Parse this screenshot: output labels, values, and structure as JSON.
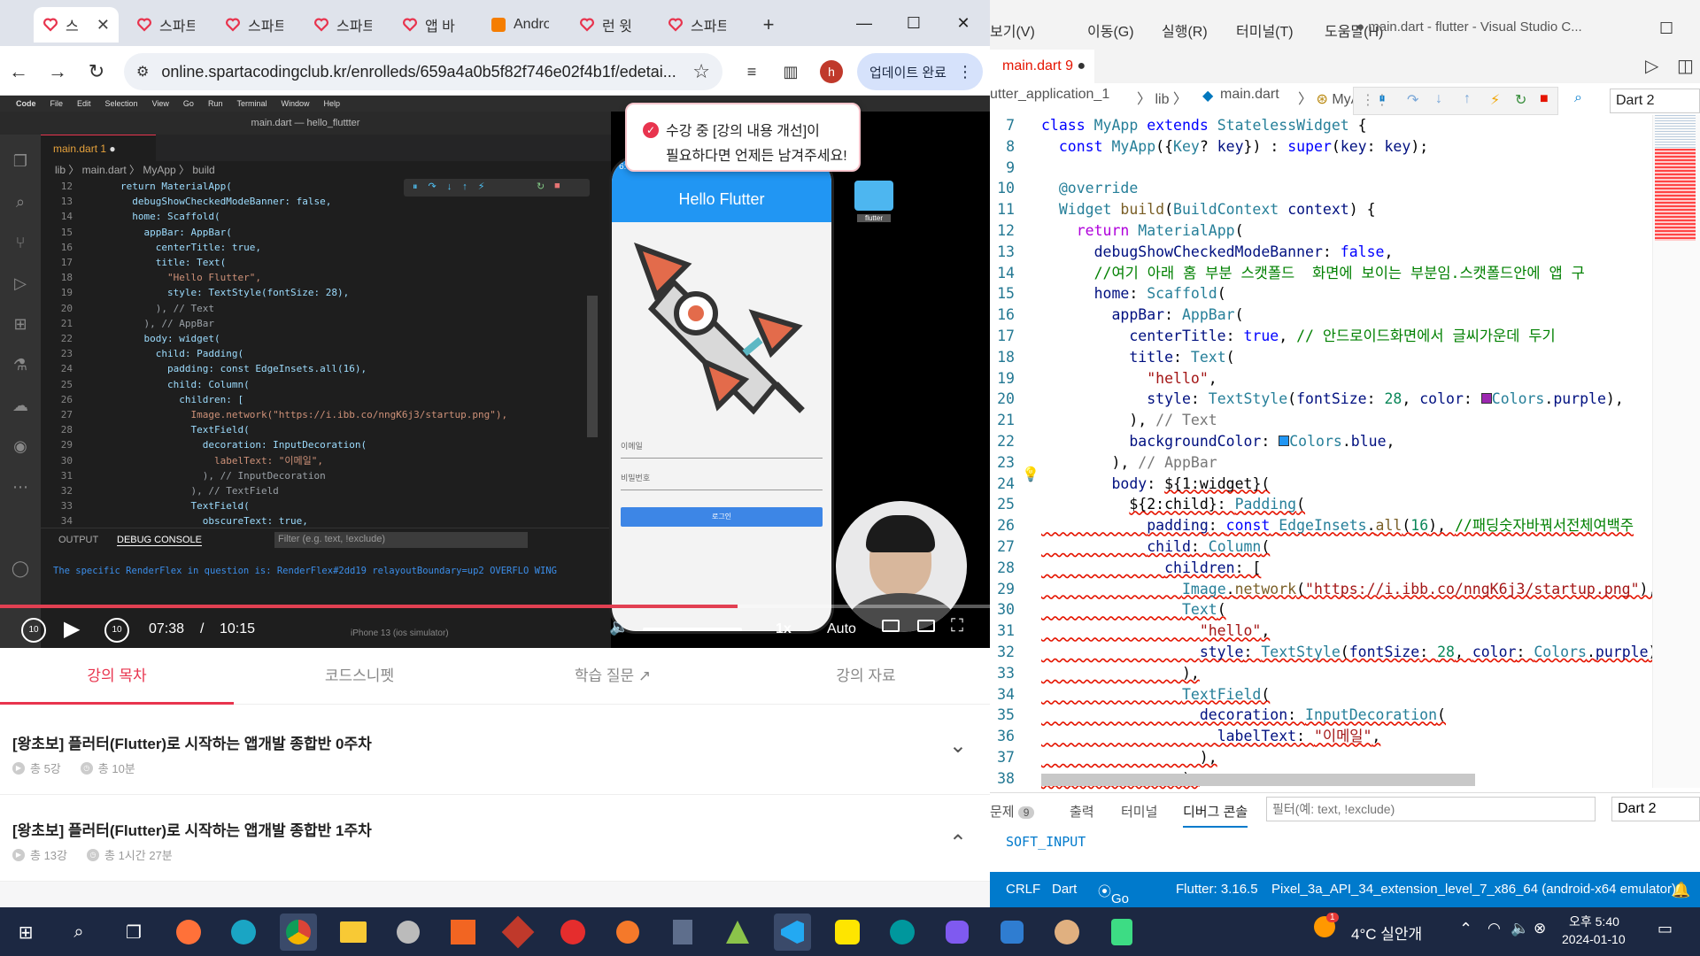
{
  "chrome": {
    "tabs": [
      {
        "label": "스"
      },
      {
        "label": "스파트"
      },
      {
        "label": "스파트"
      },
      {
        "label": "스파트"
      },
      {
        "label": "앱 바"
      },
      {
        "label": "Andro"
      },
      {
        "label": "런 윗"
      },
      {
        "label": "스파트"
      }
    ],
    "new_tab": "+",
    "url": "online.spartacodingclub.kr/enrolleds/659a4a0b5f82f746e02f4b1f/edetai...",
    "profile_initial": "h",
    "update_label": "업데이트 완료",
    "colors": {
      "accent": "#e8344e",
      "update_bg": "#d6e2fb"
    }
  },
  "video": {
    "mac_menu": [
      "Code",
      "File",
      "Edit",
      "Selection",
      "View",
      "Go",
      "Run",
      "Terminal",
      "Window",
      "Help"
    ],
    "window_title": "main.dart — hello_fluttter",
    "tab_label": "main.dart 1",
    "breadcrumb": "lib 〉 main.dart 〉 MyApp 〉 build",
    "code_lines": [
      {
        "n": "12",
        "t": "return MaterialApp("
      },
      {
        "n": "13",
        "t": "  debugShowCheckedModeBanner: false,"
      },
      {
        "n": "14",
        "t": "  home: Scaffold("
      },
      {
        "n": "15",
        "t": "    appBar: AppBar("
      },
      {
        "n": "16",
        "t": "      centerTitle: true,"
      },
      {
        "n": "17",
        "t": "      title: Text("
      },
      {
        "n": "18",
        "t": "        \"Hello Flutter\","
      },
      {
        "n": "19",
        "t": "        style: TextStyle(fontSize: 28),"
      },
      {
        "n": "20",
        "t": "      ), // Text"
      },
      {
        "n": "21",
        "t": "    ), // AppBar"
      },
      {
        "n": "22",
        "t": "    body: widget("
      },
      {
        "n": "23",
        "t": "      child: Padding("
      },
      {
        "n": "24",
        "t": "        padding: const EdgeInsets.all(16),"
      },
      {
        "n": "25",
        "t": "        child: Column("
      },
      {
        "n": "26",
        "t": "          children: ["
      },
      {
        "n": "27",
        "t": "            Image.network(\"https://i.ibb.co/nngK6j3/startup.png\"),"
      },
      {
        "n": "28",
        "t": "            TextField("
      },
      {
        "n": "29",
        "t": "              decoration: InputDecoration("
      },
      {
        "n": "30",
        "t": "                labelText: \"이메일\","
      },
      {
        "n": "31",
        "t": "              ), // InputDecoration"
      },
      {
        "n": "32",
        "t": "            ), // TextField"
      },
      {
        "n": "33",
        "t": "            TextField("
      },
      {
        "n": "34",
        "t": "              obscureText: true,"
      }
    ],
    "panel_tabs": [
      "OUTPUT",
      "DEBUG CONSOLE"
    ],
    "panel_filter": "Filter (e.g. text, !exclude)",
    "console_text": "The specific RenderFlex in question is: RenderFlex#2dd19 relayoutBoundary=up2 OVERFLO WING",
    "status_hint": "iPhone 13 (ios simulator)",
    "phone": {
      "time": "6:04",
      "appbar_title": "Hello Flutter",
      "email_label": "이메일",
      "password_label": "비밀번호",
      "login_button": "로그인"
    },
    "toast": {
      "line1": "수강 중 [강의 내용 개선]이",
      "line2": "필요하다면 언제든 남겨주세요!"
    },
    "folder_label": "flutter",
    "player": {
      "current_time": "07:38",
      "separator": "/",
      "duration": "10:15",
      "speed": "1x",
      "quality": "Auto",
      "progress": 0.745,
      "rewind_label": "10",
      "forward_label": "10"
    }
  },
  "lecture": {
    "tabs": [
      {
        "label": "강의 목차",
        "active": true
      },
      {
        "label": "코드스니펫",
        "active": false
      },
      {
        "label": "학습 질문",
        "active": false
      },
      {
        "label": "강의 자료",
        "active": false
      }
    ],
    "sections": [
      {
        "title": "[왕초보] 플러터(Flutter)로 시작하는 앱개발 종합반 0주차",
        "count": "총 5강",
        "time": "총 10분",
        "chevron": "⌄"
      },
      {
        "title": "[왕초보] 플러터(Flutter)로 시작하는 앱개발 종합반 1주차",
        "count": "총 13강",
        "time": "총 1시간 27분",
        "chevron": "⌃"
      }
    ]
  },
  "vscode": {
    "menu": [
      "보기(V)",
      "이동(G)",
      "실행(R)",
      "터미널(T)",
      "도움말(H)"
    ],
    "title": "● main.dart - flutter - Visual Studio C...",
    "tab": "main.dart 9",
    "breadcrumb": [
      "utter_application_1",
      "lib",
      "main.dart",
      "MyApp"
    ],
    "dart_select": "Dart 2",
    "lines": [
      "7",
      "8",
      "9",
      "10",
      "11",
      "12",
      "13",
      "14",
      "15",
      "16",
      "17",
      "18",
      "19",
      "20",
      "21",
      "22",
      "23",
      "24",
      "25",
      "26",
      "27",
      "28",
      "29",
      "30",
      "31",
      "32",
      "33",
      "34",
      "35",
      "36",
      "37",
      "38"
    ],
    "bottom_tabs": [
      {
        "label": "문제",
        "badge": "9"
      },
      {
        "label": "출력"
      },
      {
        "label": "터미널"
      },
      {
        "label": "디버그 콘솔"
      }
    ],
    "filter_placeholder": "필터(예: text, !exclude)",
    "bottom_dart": "Dart 2",
    "console_text": "SOFT_INPUT",
    "status": [
      "CRLF",
      "Dart",
      "Go Live",
      "Flutter: 3.16.5",
      "Pixel_3a_API_34_extension_level_7_x86_64 (android-x64 emulator)"
    ],
    "colors": {
      "status_bar": "#007acc",
      "purple": "#9c27b0",
      "blue": "#2196f3"
    }
  },
  "taskbar": {
    "weather": "4°C 실안개",
    "weather_badge": "1",
    "time": "오후 5:40",
    "date": "2024-01-10"
  }
}
